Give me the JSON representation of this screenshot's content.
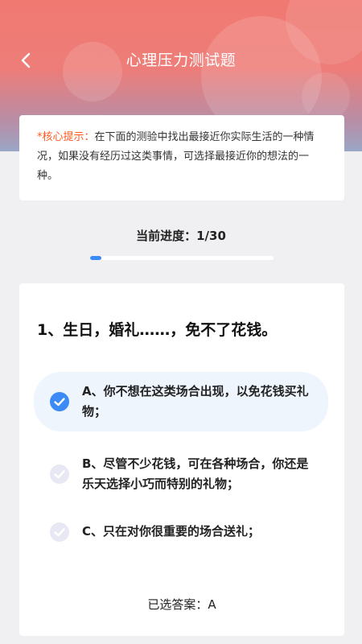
{
  "header": {
    "title": "心理压力测试题",
    "back_icon": "chevron-left-icon"
  },
  "tip": {
    "label": "*核心提示：",
    "text": "在下面的测验中找出最接近你实际生活的一种情况，如果没有经历过这类事情，可选择最接近你的想法的一种。"
  },
  "progress": {
    "label": "当前进度：",
    "value": "1/30",
    "current": 1,
    "total": 30,
    "fraction": 0.06
  },
  "question": {
    "text": "1、生日，婚礼……，免不了花钱。",
    "options": [
      {
        "label": "A、你不想在这类场合出现，以免花钱买礼物；",
        "selected": true
      },
      {
        "label": "B、尽管不少花钱，可在各种场合，你还是乐天选择小巧而特别的礼物；",
        "selected": false
      },
      {
        "label": "C、只在对你很重要的场合送礼；",
        "selected": false
      }
    ]
  },
  "answer": {
    "label": "已选答案：",
    "value": "A"
  },
  "colors": {
    "accent": "#3b8af6",
    "tip_label": "#ff5a1f",
    "check_inactive": "#e8e8f4"
  }
}
